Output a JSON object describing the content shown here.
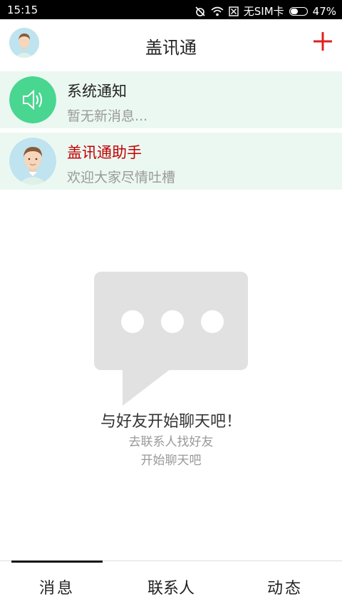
{
  "status_bar": {
    "time": "15:15",
    "sim": "无SIM卡",
    "battery": "47%",
    "icons": [
      "alarm-off-icon",
      "wifi-icon",
      "no-sim-icon",
      "battery-icon"
    ]
  },
  "header": {
    "title": "盖讯通",
    "add_icon": "plus-icon",
    "accent_color": "#e02020"
  },
  "conversations": [
    {
      "name": "系统通知",
      "preview": "暂无新消息...",
      "icon": "speaker-icon",
      "name_color": "#222222"
    },
    {
      "name": "盖讯通助手",
      "preview": "欢迎大家尽情吐槽",
      "icon": "avatar",
      "name_color": "#c00000"
    }
  ],
  "empty_state": {
    "icon": "chat-bubble-icon",
    "title": "与好友开始聊天吧！",
    "line1": "去联系人找好友",
    "line2": "开始聊天吧"
  },
  "bottom_nav": {
    "tabs": [
      "消息",
      "联系人",
      "动态"
    ],
    "active": "消息"
  }
}
